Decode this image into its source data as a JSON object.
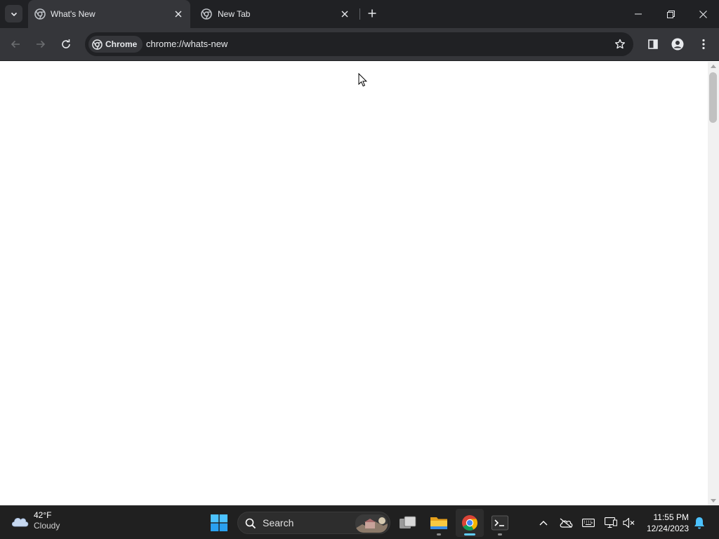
{
  "browser": {
    "tabs": [
      {
        "title": "What's New",
        "active": true
      },
      {
        "title": "New Tab",
        "active": false
      }
    ],
    "chip_label": "Chrome",
    "url": "chrome://whats-new"
  },
  "taskbar": {
    "weather": {
      "temp": "42°F",
      "condition": "Cloudy"
    },
    "search_label": "Search",
    "clock": {
      "time": "11:55 PM",
      "date": "12/24/2023"
    },
    "apps": [
      "start",
      "search",
      "task-view",
      "file-explorer",
      "chrome",
      "terminal"
    ],
    "active_app": "chrome"
  },
  "colors": {
    "titlebar": "#202124",
    "toolbar": "#35363a",
    "accent": "#60cdff"
  }
}
